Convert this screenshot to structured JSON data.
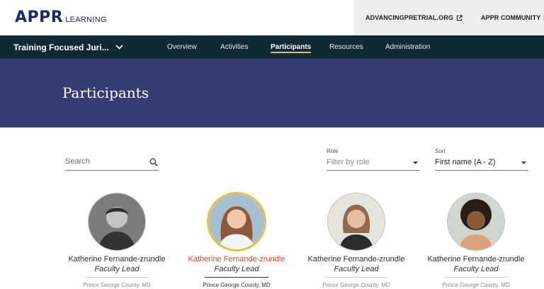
{
  "header": {
    "logo_main": "APPR",
    "logo_sub": "LEARNING",
    "links": [
      {
        "label": "ADVANCINGPRETRIAL.ORG",
        "icon": "external-link-icon"
      },
      {
        "label": "APPR COMMUNITY",
        "icon": "external-link-icon"
      }
    ]
  },
  "nav": {
    "jurisdiction": "Training Focused Juri...",
    "items": [
      {
        "label": "Overview",
        "active": false
      },
      {
        "label": "Activities",
        "active": false
      },
      {
        "label": "Participants",
        "active": true
      },
      {
        "label": "Resources",
        "active": false
      },
      {
        "label": "Administration",
        "active": false
      }
    ]
  },
  "hero": {
    "title": "Participants"
  },
  "filters": {
    "search": {
      "placeholder": "Search",
      "value": ""
    },
    "role": {
      "label": "Role",
      "value": "Filter by role"
    },
    "sort": {
      "label": "Sort",
      "value": "First name (A - Z)"
    }
  },
  "participants": [
    {
      "name": "Katherine Fernande-zrundle",
      "role": "Faculty Lead",
      "location": "Prince George County, MD",
      "active": false
    },
    {
      "name": "Katherine Fernande-zrundle",
      "role": "Faculty Lead",
      "location": "Prince George County, MD",
      "active": true
    },
    {
      "name": "Katherine Fernande-zrundle",
      "role": "Faculty Lead",
      "location": "Prince George County, MD",
      "active": false
    },
    {
      "name": "Katherine Fernande-zrundle",
      "role": "Faculty Lead",
      "location": "Prince George County, MD",
      "active": false
    }
  ],
  "colors": {
    "navy": "#1f2a60",
    "nav_bg": "#0f2a33",
    "hero_bg": "#363d73",
    "accent_gold": "#e2c24a",
    "active_name": "#cf4a2d"
  }
}
